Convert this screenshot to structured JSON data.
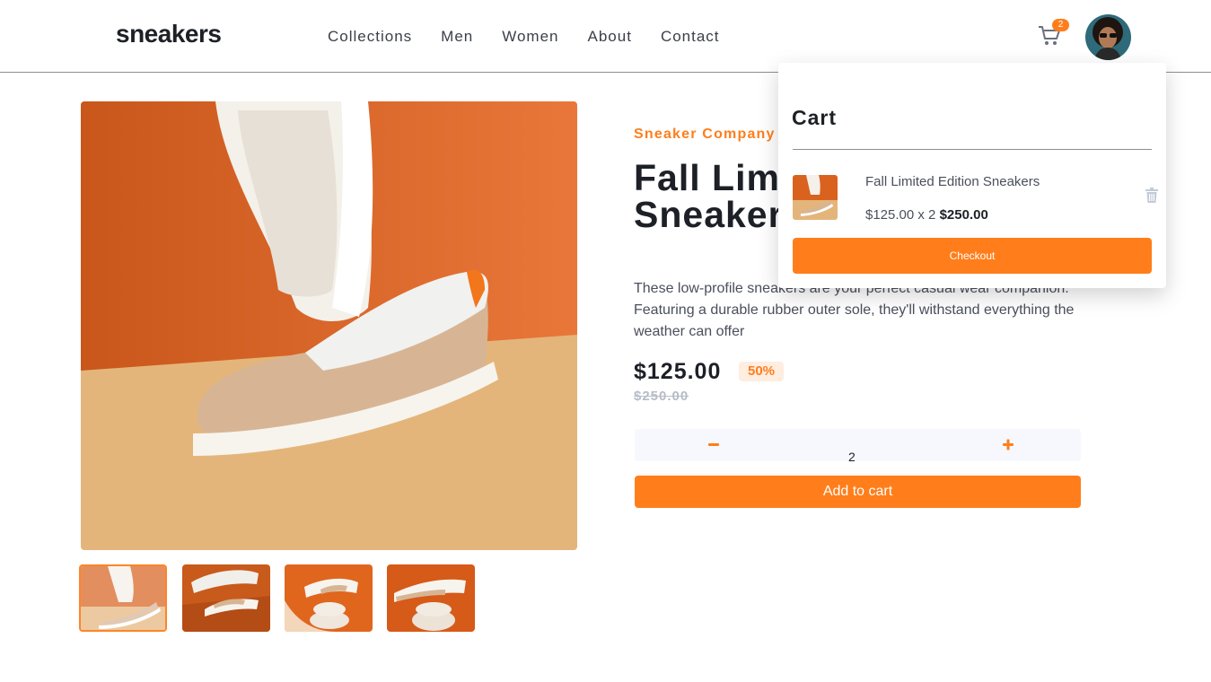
{
  "header": {
    "logo": "sneakers",
    "nav": [
      "Collections",
      "Men",
      "Women",
      "About",
      "Contact"
    ],
    "cart_count": "2"
  },
  "product": {
    "company": "Sneaker Company",
    "title": "Fall Limited Edition Sneakers",
    "description": "These low-profile sneakers are your perfect casual wear companion. Featuring a durable rubber outer sole, they'll withstand everything the weather can offer",
    "price": "$125.00",
    "discount": "50%",
    "old_price": "$250.00",
    "quantity": "2",
    "add_to_cart": "Add to cart"
  },
  "cart": {
    "title": "Cart",
    "item_name": "Fall Limited Edition Sneakers",
    "item_price": "$125.00 x 2",
    "item_total": "$250.00",
    "checkout": "Checkout"
  },
  "colors": {
    "accent": "#ff7e1b",
    "accent_pale": "#ffede0",
    "dark": "#1d2026",
    "grey": "#b6bcc8"
  }
}
